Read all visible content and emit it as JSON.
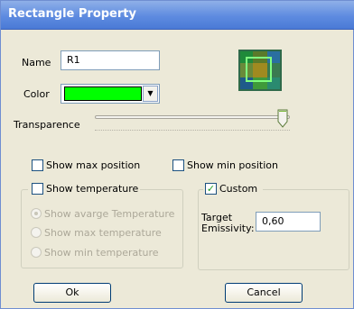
{
  "window": {
    "title": "Rectangle Property"
  },
  "name_field": {
    "label": "Name",
    "value": "R1"
  },
  "color_field": {
    "label": "Color",
    "swatch_color": "#00ff00"
  },
  "transparence": {
    "label": "Transparence",
    "level_percent": 96
  },
  "options": {
    "show_max_position": {
      "label": "Show max position",
      "checked": false
    },
    "show_min_position": {
      "label": "Show min position",
      "checked": false
    }
  },
  "temperature_group": {
    "checkbox_label": "Show temperature",
    "checked": false,
    "radios": [
      {
        "label": "Show avarge Temperature",
        "selected": true
      },
      {
        "label": "Show max temperature",
        "selected": false
      },
      {
        "label": "Show min temperature",
        "selected": false
      }
    ]
  },
  "custom_group": {
    "checkbox_label": "Custom",
    "checked": true,
    "emissivity_label_line1": "Target",
    "emissivity_label_line2": "Emissivity:",
    "emissivity_value": "0,60"
  },
  "buttons": {
    "ok": "Ok",
    "cancel": "Cancel"
  },
  "icons": {
    "preview": "rectangle-preview-icon",
    "dropdown": "chevron-down-icon",
    "check": "check-icon"
  }
}
